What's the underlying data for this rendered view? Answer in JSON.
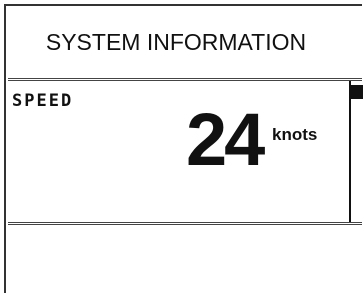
{
  "header": {
    "title": "SYSTEM INFORMATION"
  },
  "speed": {
    "label": "SPEED",
    "value": "24",
    "unit": "knots"
  }
}
